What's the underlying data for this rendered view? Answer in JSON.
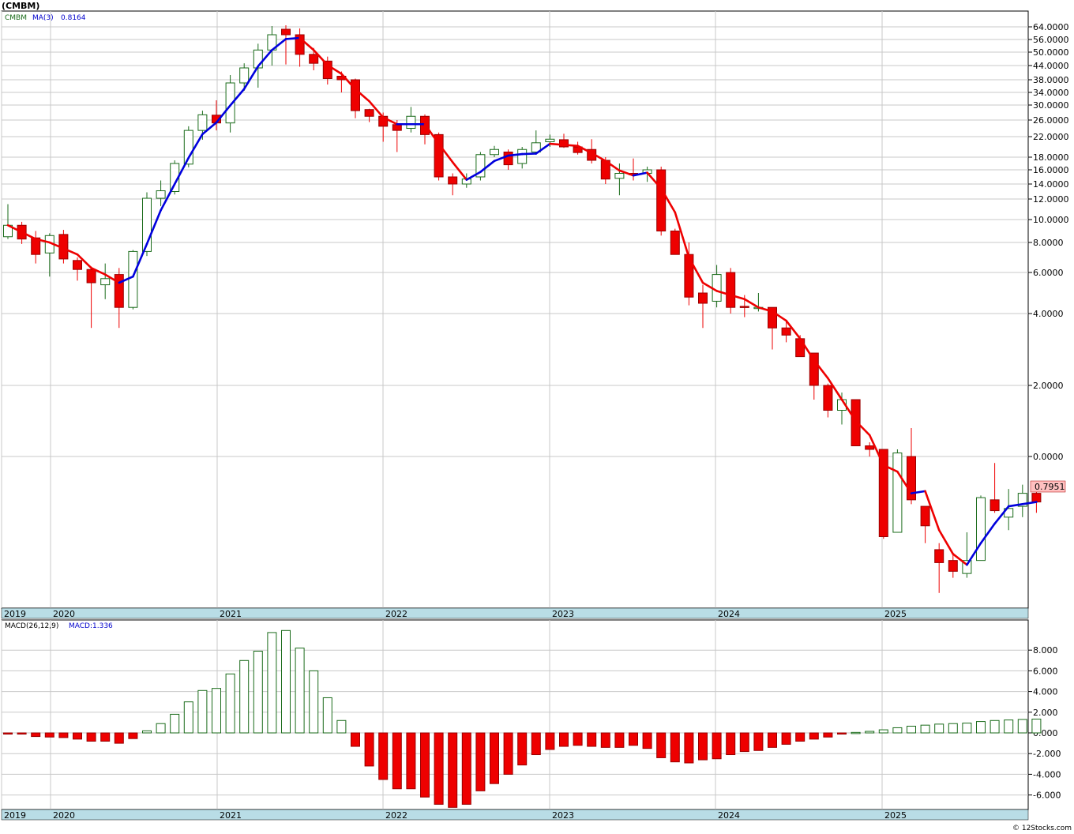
{
  "title": "(CMBM)",
  "price_legend": {
    "symbol": "CMBM",
    "ma_label": "MA(3)",
    "ma_value": "0.8164"
  },
  "macd_legend": {
    "label": "MACD(26,12,9)",
    "value": "MACD:1.336"
  },
  "last_price_tag": "0.7951",
  "watermark": "© 12Stocks.com",
  "colors": {
    "up": "#1a6b1a",
    "down": "#ee0000",
    "ma_up": "#0000dd",
    "ma_down": "#ee0000",
    "axis_band": "#b9dde6",
    "grid": "#c8c8c8"
  },
  "chart_data": [
    {
      "type": "candlestick",
      "title": "(CMBM)",
      "scale": "log",
      "y_tick_labels": [
        "64.0000",
        "56.0000",
        "50.0000",
        "44.0000",
        "38.0000",
        "34.0000",
        "30.0000",
        "26.0000",
        "22.0000",
        "18.0000",
        "16.0000",
        "14.0000",
        "12.0000",
        "10.0000",
        "8.0000",
        "6.0000",
        "4.0000",
        "2.0000",
        "0.0000"
      ],
      "x_tick_labels": [
        "2019",
        "2020",
        "2021",
        "2022",
        "2023",
        "2024",
        "2025"
      ],
      "last_value": "0.7951",
      "series": [
        {
          "name": "CMBM",
          "ohlc": [
            [
              8.5,
              11.5,
              8.3,
              9.5
            ],
            [
              9.5,
              9.8,
              7.9,
              8.3
            ],
            [
              8.4,
              9.0,
              6.6,
              7.2
            ],
            [
              7.3,
              8.8,
              5.8,
              8.6
            ],
            [
              8.7,
              9.1,
              6.6,
              6.9
            ],
            [
              6.8,
              7.0,
              5.6,
              6.2
            ],
            [
              6.2,
              6.4,
              3.6,
              5.5
            ],
            [
              5.4,
              6.6,
              4.7,
              5.7
            ],
            [
              5.9,
              6.3,
              3.6,
              4.3
            ],
            [
              4.3,
              7.5,
              4.2,
              7.4
            ],
            [
              7.4,
              12.9,
              7.1,
              12.1
            ],
            [
              12.1,
              14.5,
              11.3,
              13.1
            ],
            [
              13.0,
              17.5,
              12.6,
              17.0
            ],
            [
              16.9,
              24.5,
              16.4,
              23.5
            ],
            [
              23.5,
              28.5,
              21.4,
              27.4
            ],
            [
              27.3,
              31.5,
              23.5,
              25.3
            ],
            [
              25.3,
              40.0,
              23.0,
              37.0
            ],
            [
              37.0,
              45.0,
              34.5,
              43.0
            ],
            [
              43.0,
              54.0,
              35.5,
              51.0
            ],
            [
              51.0,
              65.0,
              44.0,
              59.0
            ],
            [
              62.5,
              66.0,
              44.5,
              59.0
            ],
            [
              59.0,
              63.0,
              43.5,
              49.0
            ],
            [
              49.0,
              52.0,
              42.0,
              45.0
            ],
            [
              46.0,
              48.0,
              36.5,
              38.5
            ],
            [
              39.5,
              41.5,
              34.0,
              38.0
            ],
            [
              38.0,
              38.5,
              26.5,
              28.5
            ],
            [
              28.8,
              29.0,
              25.5,
              27.0
            ],
            [
              27.0,
              28.0,
              21.0,
              24.5
            ],
            [
              24.9,
              26.0,
              19.0,
              23.5
            ],
            [
              24.0,
              29.5,
              23.0,
              27.0
            ],
            [
              27.0,
              27.5,
              20.5,
              22.5
            ],
            [
              22.5,
              23.0,
              14.5,
              15.0
            ],
            [
              15.0,
              15.5,
              12.5,
              14.0
            ],
            [
              14.0,
              15.5,
              13.5,
              14.7
            ],
            [
              15.0,
              19.0,
              14.5,
              18.5
            ],
            [
              18.5,
              20.2,
              18.0,
              19.5
            ],
            [
              19.0,
              19.5,
              16.0,
              16.8
            ],
            [
              17.0,
              20.0,
              16.2,
              19.5
            ],
            [
              19.0,
              23.5,
              18.5,
              20.8
            ],
            [
              21.0,
              22.5,
              20.0,
              21.5
            ],
            [
              21.4,
              22.7,
              19.8,
              20.0
            ],
            [
              20.0,
              21.0,
              18.5,
              18.9
            ],
            [
              19.5,
              21.5,
              17.0,
              17.5
            ],
            [
              17.5,
              18.0,
              14.0,
              14.7
            ],
            [
              14.8,
              17.0,
              12.5,
              15.5
            ],
            [
              15.5,
              17.8,
              14.5,
              15.3
            ],
            [
              15.5,
              16.5,
              14.3,
              16.0
            ],
            [
              16.0,
              16.5,
              8.6,
              9.0
            ],
            [
              9.0,
              9.2,
              7.2,
              7.2
            ],
            [
              7.2,
              8.0,
              4.4,
              4.8
            ],
            [
              5.0,
              5.4,
              3.6,
              4.5
            ],
            [
              4.6,
              6.5,
              4.3,
              5.9
            ],
            [
              6.0,
              6.3,
              4.0,
              4.3
            ],
            [
              4.35,
              4.9,
              3.9,
              4.3
            ],
            [
              4.3,
              5.0,
              4.1,
              4.3
            ],
            [
              4.3,
              4.3,
              3.0,
              3.6
            ],
            [
              3.6,
              3.8,
              3.2,
              3.4
            ],
            [
              3.3,
              3.4,
              2.8,
              2.8
            ],
            [
              2.9,
              2.9,
              1.8,
              2.0
            ],
            [
              2.0,
              2.05,
              1.55,
              1.65
            ],
            [
              1.65,
              1.9,
              1.45,
              1.8
            ],
            [
              1.8,
              1.8,
              1.15,
              1.15
            ],
            [
              1.15,
              1.2,
              1.0,
              1.1
            ],
            [
              1.1,
              1.1,
              0.62,
              0.63
            ],
            [
              0.65,
              1.1,
              0.65,
              1.05
            ],
            [
              1.0,
              1.4,
              0.78,
              0.8
            ],
            [
              0.77,
              0.77,
              0.6,
              0.68
            ],
            [
              0.57,
              0.6,
              0.37,
              0.51
            ],
            [
              0.52,
              0.55,
              0.44,
              0.47
            ],
            [
              0.46,
              0.65,
              0.44,
              0.52
            ],
            [
              0.52,
              0.82,
              0.52,
              0.81
            ],
            [
              0.8,
              0.97,
              0.74,
              0.75
            ],
            [
              0.72,
              0.85,
              0.66,
              0.76
            ],
            [
              0.77,
              0.87,
              0.72,
              0.83
            ],
            [
              0.83,
              0.84,
              0.74,
              0.79
            ]
          ]
        },
        {
          "name": "MA(3)",
          "values": [
            9.5,
            8.9,
            8.3,
            8.0,
            7.6,
            7.2,
            6.3,
            5.9,
            5.5,
            5.8,
            7.9,
            10.9,
            14.0,
            17.9,
            22.6,
            25.4,
            29.9,
            35.1,
            43.7,
            51.0,
            56.3,
            57.0,
            51.0,
            44.2,
            40.5,
            35.0,
            31.2,
            26.7,
            25.0,
            25.0,
            25.0,
            20.6,
            17.2,
            14.6,
            15.7,
            17.4,
            18.3,
            18.6,
            18.7,
            20.6,
            20.4,
            20.2,
            18.8,
            17.4,
            15.9,
            15.2,
            15.6,
            13.4,
            10.7,
            7.0,
            5.5,
            5.1,
            4.9,
            4.7,
            4.3,
            4.1,
            3.8,
            3.3,
            2.7,
            2.2,
            1.8,
            1.5,
            1.3,
            0.96,
            0.93,
            0.83,
            0.84,
            0.66,
            0.55,
            0.5,
            0.6,
            0.69,
            0.77,
            0.78,
            0.79
          ]
        }
      ]
    },
    {
      "type": "bar",
      "title": "MACD(26,12,9)",
      "y_tick_labels": [
        "8.000",
        "6.000",
        "4.000",
        "2.000",
        "0.000",
        "-2.000",
        "-4.000",
        "-6.000"
      ],
      "x_tick_labels": [
        "2019",
        "2020",
        "2021",
        "2022",
        "2023",
        "2024",
        "2025"
      ],
      "values": [
        -0.1,
        -0.1,
        -0.35,
        -0.4,
        -0.45,
        -0.6,
        -0.8,
        -0.8,
        -1.0,
        -0.55,
        0.2,
        0.9,
        1.8,
        3.0,
        4.1,
        4.3,
        5.7,
        7.0,
        7.9,
        9.7,
        9.9,
        8.2,
        6.0,
        3.4,
        1.2,
        -1.3,
        -3.2,
        -4.5,
        -5.4,
        -5.4,
        -6.2,
        -6.9,
        -7.2,
        -6.9,
        -5.6,
        -4.9,
        -4.0,
        -3.1,
        -2.1,
        -1.6,
        -1.3,
        -1.2,
        -1.3,
        -1.4,
        -1.4,
        -1.2,
        -1.5,
        -2.4,
        -2.8,
        -2.9,
        -2.6,
        -2.5,
        -2.1,
        -1.8,
        -1.7,
        -1.4,
        -1.1,
        -0.8,
        -0.6,
        -0.4,
        -0.1,
        0.05,
        0.15,
        0.3,
        0.5,
        0.65,
        0.75,
        0.85,
        0.9,
        0.95,
        1.1,
        1.2,
        1.25,
        1.3,
        1.336
      ]
    }
  ]
}
